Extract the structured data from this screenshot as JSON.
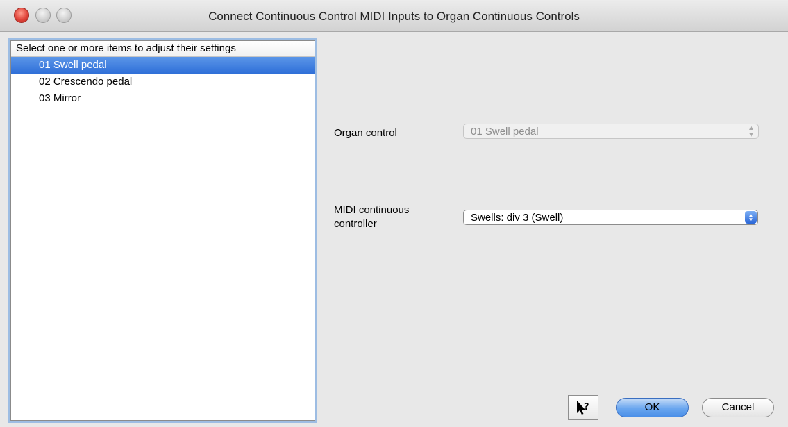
{
  "window": {
    "title": "Connect Continuous Control MIDI Inputs to Organ Continuous Controls"
  },
  "list": {
    "header": "Select one or more items to adjust their settings",
    "items": [
      {
        "label": "01 Swell pedal",
        "selected": true
      },
      {
        "label": "02 Crescendo pedal",
        "selected": false
      },
      {
        "label": "03 Mirror",
        "selected": false
      }
    ]
  },
  "form": {
    "organ_control_label": "Organ control",
    "organ_control_value": "01 Swell pedal",
    "midi_controller_label": "MIDI continuous controller",
    "midi_controller_value": "Swells: div 3 (Swell)"
  },
  "buttons": {
    "ok": "OK",
    "cancel": "Cancel"
  },
  "colors": {
    "selection": "#3a7ae0",
    "focus_ring": "#9dbde3"
  },
  "icons": {
    "help": "help-pointer-icon"
  }
}
